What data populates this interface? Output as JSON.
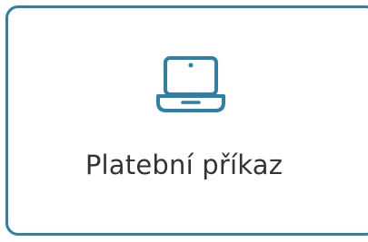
{
  "card": {
    "label": "Platební příkaz",
    "icon": "laptop-icon",
    "border_color": "#2f7fa6",
    "text_color": "#333333"
  }
}
